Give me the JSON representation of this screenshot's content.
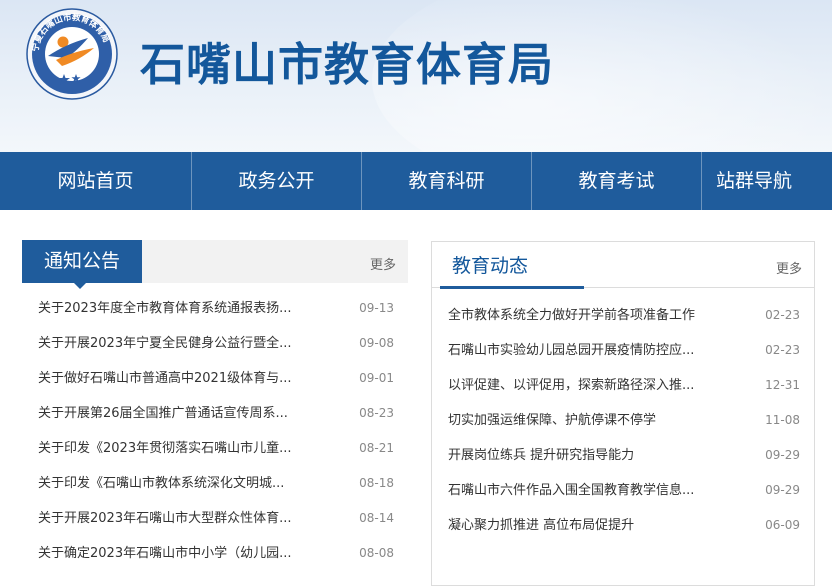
{
  "header": {
    "site_title": "石嘴山市教育体育局",
    "logo_text": "宁夏石嘴山市教育体育局"
  },
  "nav": {
    "items": [
      {
        "label": "网站首页"
      },
      {
        "label": "政务公开"
      },
      {
        "label": "教育科研"
      },
      {
        "label": "教育考试"
      },
      {
        "label": "站群导航"
      }
    ]
  },
  "notices": {
    "title": "通知公告",
    "more": "更多",
    "items": [
      {
        "title": "关于2023年度全市教育体育系统通报表扬...",
        "date": "09-13"
      },
      {
        "title": "关于开展2023年宁夏全民健身公益行暨全...",
        "date": "09-08"
      },
      {
        "title": "关于做好石嘴山市普通高中2021级体育与...",
        "date": "09-01"
      },
      {
        "title": "关于开展第26届全国推广普通话宣传周系...",
        "date": "08-23"
      },
      {
        "title": "关于印发《2023年贯彻落实石嘴山市儿童...",
        "date": "08-21"
      },
      {
        "title": "关于印发《石嘴山市教体系统深化文明城...",
        "date": "08-18"
      },
      {
        "title": "关于开展2023年石嘴山市大型群众性体育...",
        "date": "08-14"
      },
      {
        "title": "关于确定2023年石嘴山市中小学（幼儿园...",
        "date": "08-08"
      }
    ]
  },
  "news": {
    "title": "教育动态",
    "more": "更多",
    "items": [
      {
        "title": "全市教体系统全力做好开学前各项准备工作",
        "date": "02-23"
      },
      {
        "title": "石嘴山市实验幼儿园总园开展疫情防控应...",
        "date": "02-23"
      },
      {
        "title": "以评促建、以评促用，探索新路径深入推...",
        "date": "12-31"
      },
      {
        "title": "切实加强运维保障、护航停课不停学",
        "date": "11-08"
      },
      {
        "title": "开展岗位练兵 提升研究指导能力",
        "date": "09-29"
      },
      {
        "title": "石嘴山市六件作品入围全国教育教学信息...",
        "date": "09-29"
      },
      {
        "title": "凝心聚力抓推进 高位布局促提升",
        "date": "06-09"
      }
    ]
  },
  "colors": {
    "brand_blue": "#1f5c9c",
    "title_blue": "#13579b",
    "logo_orange": "#f08a24"
  },
  "icons": {
    "logo": "education-bureau-emblem-icon"
  }
}
